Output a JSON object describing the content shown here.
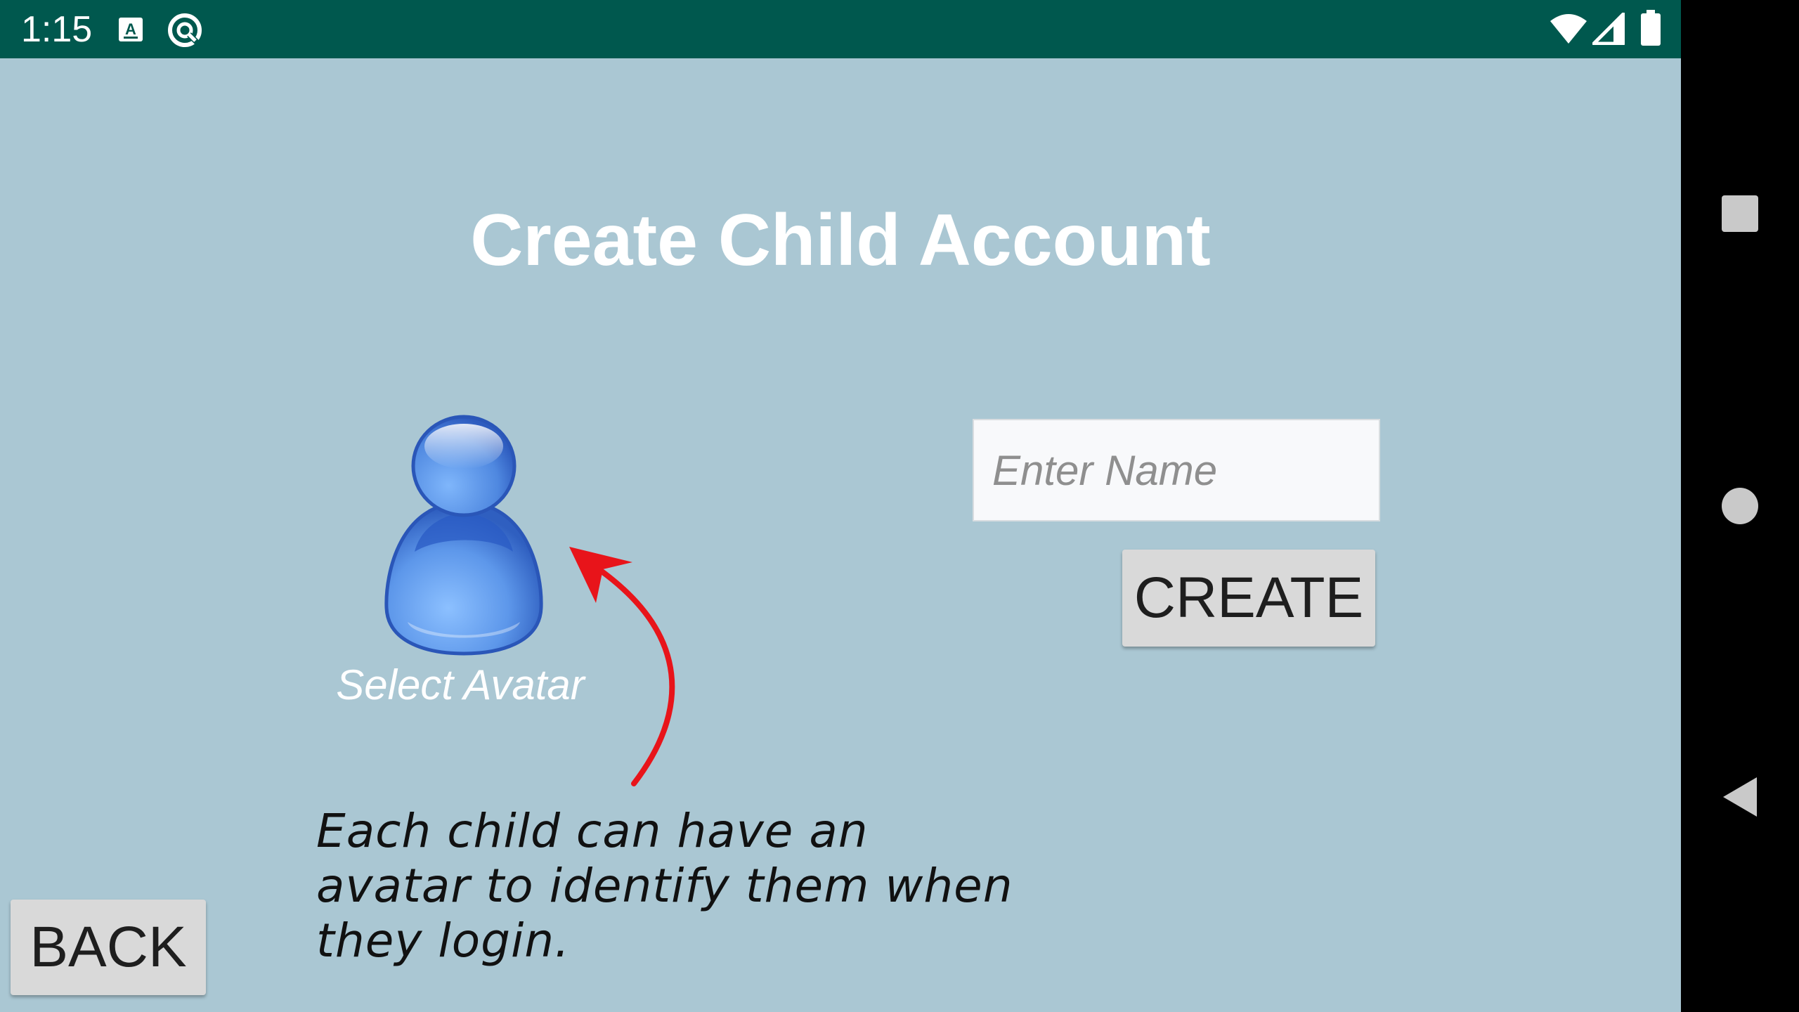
{
  "status_bar": {
    "time": "1:15",
    "background_color": "#00584e",
    "left_icons": [
      "keyboard-a-icon",
      "data-saver-icon"
    ],
    "right_icons": [
      "wifi-icon",
      "cellular-signal-icon",
      "battery-icon"
    ]
  },
  "screen": {
    "background_color": "#aac7d3",
    "title": "Create Child Account",
    "avatar": {
      "icon": "person-avatar-icon",
      "caption": "Select Avatar"
    },
    "name_input": {
      "value": "",
      "placeholder": "Enter Name"
    },
    "create_button_label": "CREATE",
    "back_button_label": "BACK"
  },
  "annotation": {
    "arrow_color": "#e8141a",
    "lines": [
      "Each child can have an",
      "avatar to identify them when",
      "they login."
    ]
  },
  "nav_bar": {
    "buttons": [
      "recents-square-icon",
      "home-circle-icon",
      "back-triangle-icon"
    ]
  }
}
